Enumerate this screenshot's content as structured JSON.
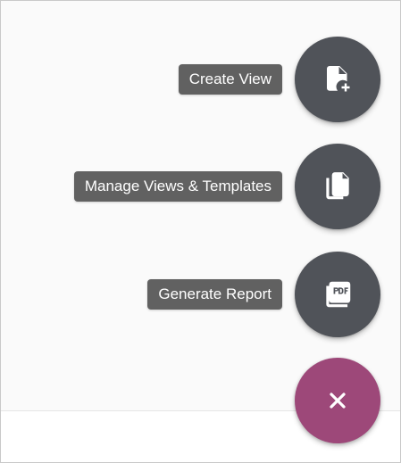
{
  "speed_dial": {
    "actions": [
      {
        "label": "Create View",
        "icon": "note-add-icon"
      },
      {
        "label": "Manage Views & Templates",
        "icon": "file-copy-icon"
      },
      {
        "label": "Generate Report",
        "icon": "pdf-icon"
      }
    ],
    "main_button": {
      "icon": "close-icon"
    },
    "colors": {
      "action_button": "#505359",
      "tooltip": "#616161",
      "main_button": "#9d4879"
    }
  }
}
